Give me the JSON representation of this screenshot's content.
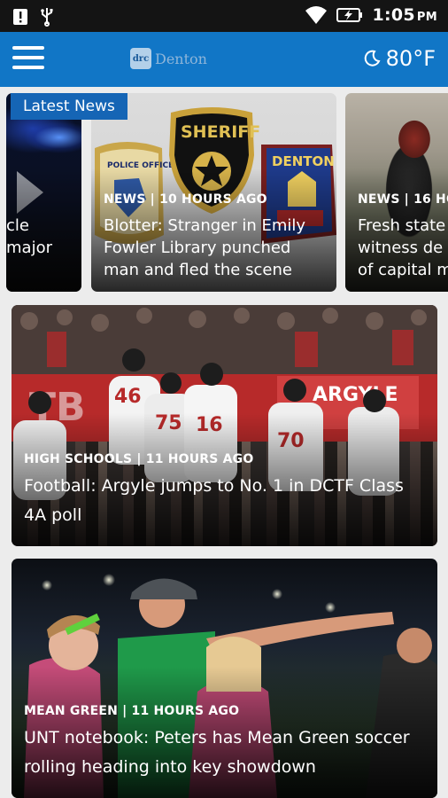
{
  "status_bar": {
    "time": "1:05",
    "ampm": "PM"
  },
  "app_bar": {
    "brand_mark": "drc",
    "brand_name": "Denton",
    "temperature": "80°F"
  },
  "carousel": {
    "badge": "Latest News",
    "items": [
      {
        "meta": "",
        "title_line1": "cle",
        "title_line2": "major"
      },
      {
        "meta": "NEWS | 10 HOURS AGO",
        "title": "Blotter: Stranger in Emily Fowler Library punched man and fled the scene",
        "sign_sheriff": "SHERIFF",
        "sign_police": "POLICE OFFICER",
        "sign_denton": "DENTON"
      },
      {
        "meta": "NEWS | 16 HO",
        "title_line1": "Fresh state",
        "title_line2": "witness de",
        "title_line3": "of capital m"
      }
    ]
  },
  "stories": [
    {
      "meta": "HIGH SCHOOLS | 11 HOURS AGO",
      "title": "Football: Argyle jumps to No. 1 in DCTF Class 4A poll",
      "banner": "ARGYLE",
      "jerseys": [
        "46",
        "75",
        "16",
        "70"
      ]
    },
    {
      "meta": "MEAN GREEN | 11 HOURS AGO",
      "title": "UNT notebook: Peters has Mean Green soccer rolling heading into key showdown"
    }
  ]
}
